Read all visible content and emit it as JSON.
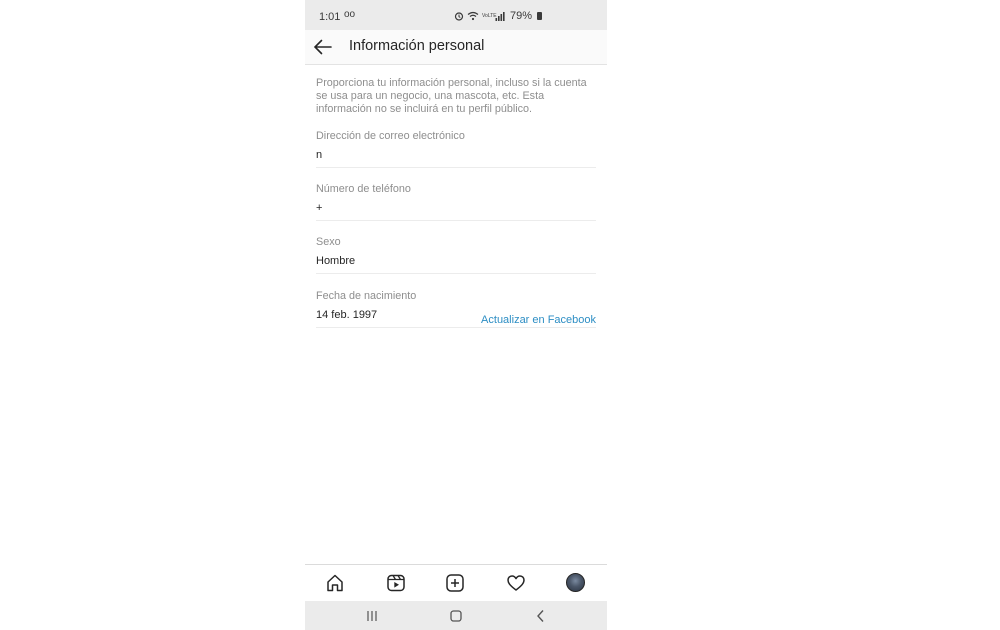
{
  "status_bar": {
    "time": "1:01",
    "voicemail": "oo",
    "network_label": "VoLTE",
    "battery": "79%"
  },
  "header": {
    "title": "Información personal"
  },
  "intro_text": "Proporciona tu información personal, incluso si la cuenta se usa para un negocio, una mascota, etc. Esta información no se incluirá en tu perfil público.",
  "fields": {
    "email": {
      "label": "Dirección de correo electrónico",
      "value": "n"
    },
    "phone": {
      "label": "Número de teléfono",
      "value": "+"
    },
    "gender": {
      "label": "Sexo",
      "value": "Hombre"
    },
    "birthday": {
      "label": "Fecha de nacimiento",
      "value": "14 feb. 1997",
      "action": "Actualizar en Facebook"
    }
  },
  "bottom_nav": {
    "items": [
      "home-icon",
      "reels-icon",
      "new-post-icon",
      "activity-icon",
      "profile-avatar"
    ]
  },
  "system_nav": {
    "items": [
      "recents-icon",
      "home-button-icon",
      "back-button-icon"
    ]
  },
  "colors": {
    "link": "#2d8ec4",
    "label": "#8e8e8e",
    "text": "#262626",
    "status_bar_bg": "#ebebeb"
  }
}
